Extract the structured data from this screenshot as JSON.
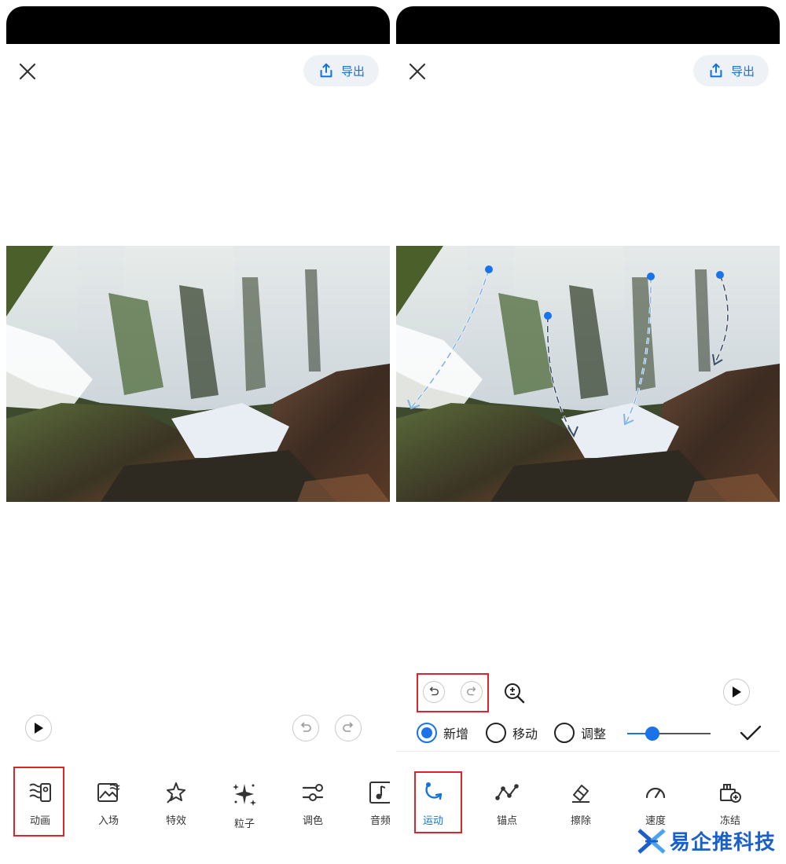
{
  "left_screen": {
    "export_label": "导出",
    "close_icon": "close-icon",
    "tools": [
      {
        "label": "动画",
        "icon": "animation-icon"
      },
      {
        "label": "入场",
        "icon": "entrance-icon"
      },
      {
        "label": "特效",
        "icon": "effects-icon"
      },
      {
        "label": "粒子",
        "icon": "particles-icon"
      },
      {
        "label": "调色",
        "icon": "color-adjust-icon"
      },
      {
        "label": "音频",
        "icon": "audio-icon"
      }
    ]
  },
  "right_screen": {
    "export_label": "导出",
    "close_icon": "close-icon",
    "modes": [
      {
        "label": "新增",
        "checked": true
      },
      {
        "label": "移动",
        "checked": false
      },
      {
        "label": "调整",
        "checked": false
      }
    ],
    "slider_value": 0.3,
    "tools": [
      {
        "label": "运动",
        "icon": "motion-icon",
        "active": true
      },
      {
        "label": "锚点",
        "icon": "anchor-points-icon",
        "active": false
      },
      {
        "label": "擦除",
        "icon": "eraser-icon",
        "active": false
      },
      {
        "label": "速度",
        "icon": "speed-icon",
        "active": false
      },
      {
        "label": "冻结",
        "icon": "freeze-icon",
        "active": false
      }
    ]
  },
  "watermark": {
    "text": "易企推科技"
  },
  "colors": {
    "accent": "#1673d6",
    "highlight": "#d9262c",
    "statusbar": "#000000"
  }
}
